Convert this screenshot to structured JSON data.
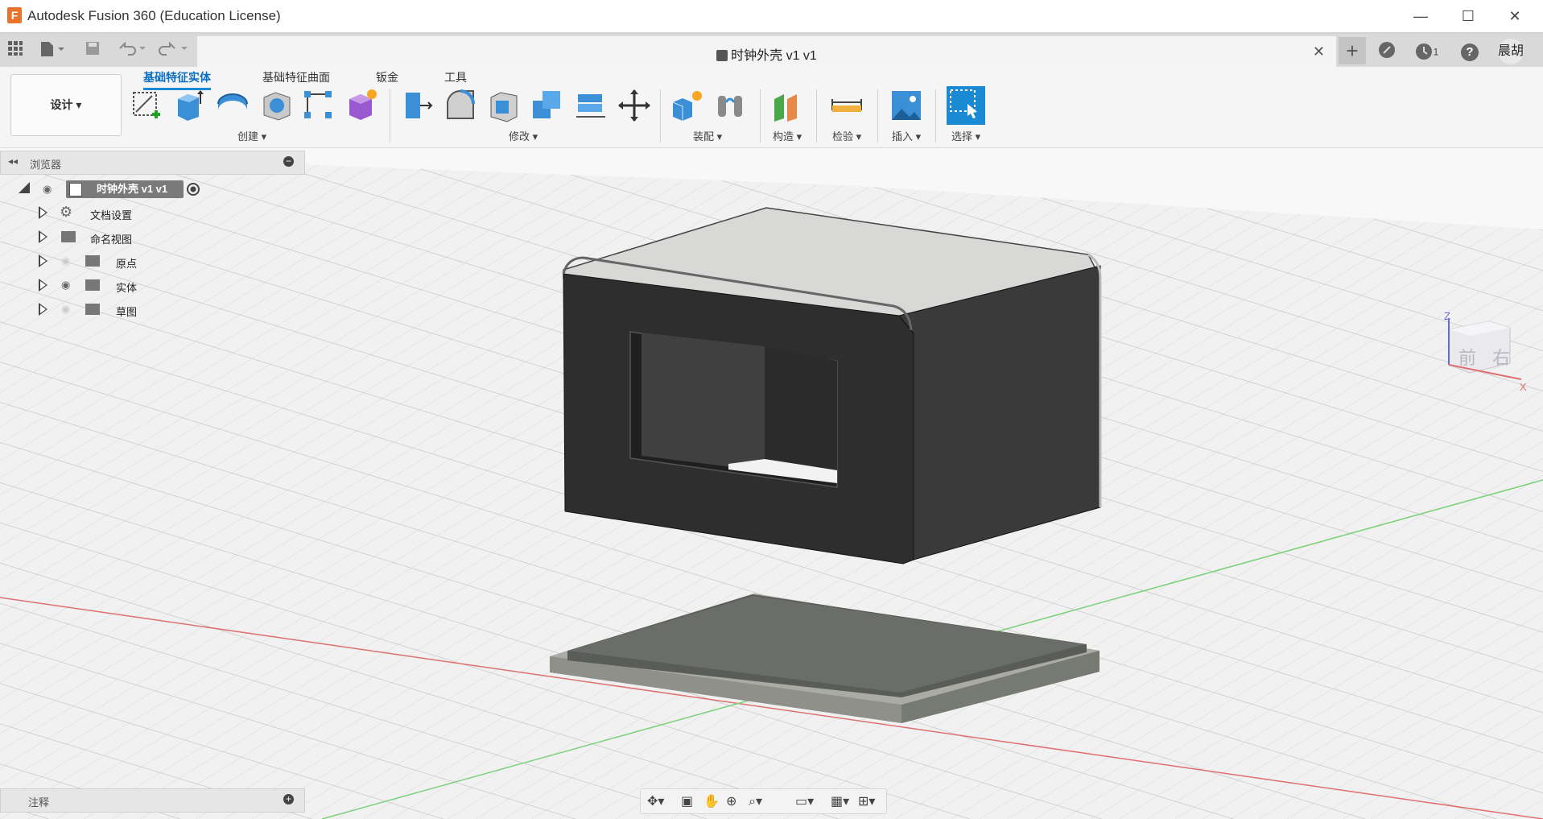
{
  "app": {
    "title": "Autodesk Fusion 360 (Education License)",
    "logo_letter": "F"
  },
  "window_controls": {
    "minimize": "—",
    "maximize": "☐",
    "close": "✕"
  },
  "tabbar": {
    "document_title": "时钟外壳 v1 v1",
    "close_glyph": "✕",
    "plus_glyph": "+",
    "jobs_count": "1",
    "help_glyph": "?",
    "user_name": "晨胡"
  },
  "toolbar": {
    "workspace_label": "设计 ▾",
    "tabs": [
      {
        "label": "基础特征实体",
        "active": true
      },
      {
        "label": "基础特征曲面",
        "active": false
      },
      {
        "label": "钣金",
        "active": false
      },
      {
        "label": "工具",
        "active": false
      }
    ],
    "groups": {
      "create": "创建 ▾",
      "modify": "修改 ▾",
      "assemble": "装配 ▾",
      "construct": "构造 ▾",
      "inspect": "检验 ▾",
      "insert": "插入 ▾",
      "select": "选择 ▾"
    }
  },
  "browser": {
    "title": "浏览器",
    "root": "时钟外壳 v1 v1",
    "items": [
      {
        "label": "文档设置",
        "icon": "gear-icon"
      },
      {
        "label": "命名视图",
        "icon": "folder-icon"
      },
      {
        "label": "原点",
        "icon": "folder-icon",
        "visibility": "hidden"
      },
      {
        "label": "实体",
        "icon": "folder-icon",
        "visibility": "visible"
      },
      {
        "label": "草图",
        "icon": "folder-icon",
        "visibility": "hidden"
      }
    ]
  },
  "annotations": {
    "title": "注释"
  },
  "viewcube": {
    "front": "前",
    "right": "右",
    "z_axis": "Z",
    "x_axis": "X"
  },
  "colors": {
    "accent": "#1a8ad4",
    "body_dark": "#2e2e2e",
    "body_top": "#d8d8d6",
    "plate": "#9a9c95",
    "grid_bg": "#f0f0f0"
  }
}
